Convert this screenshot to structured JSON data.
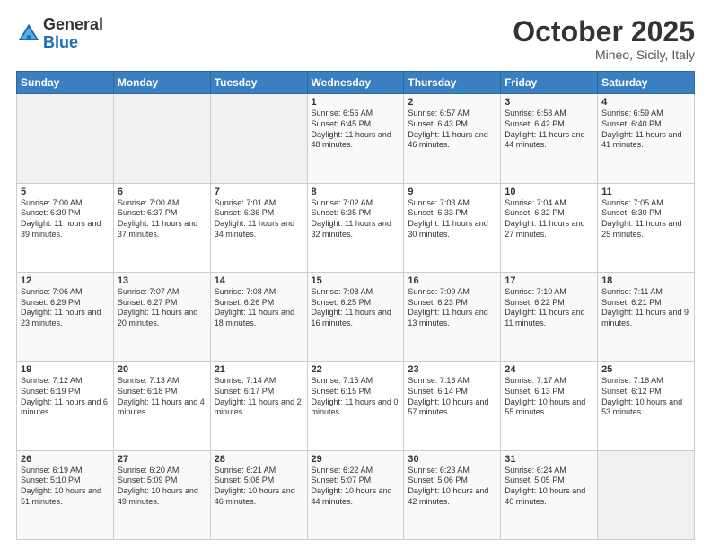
{
  "header": {
    "logo_general": "General",
    "logo_blue": "Blue",
    "month": "October 2025",
    "location": "Mineo, Sicily, Italy"
  },
  "weekdays": [
    "Sunday",
    "Monday",
    "Tuesday",
    "Wednesday",
    "Thursday",
    "Friday",
    "Saturday"
  ],
  "weeks": [
    [
      {
        "day": "",
        "info": ""
      },
      {
        "day": "",
        "info": ""
      },
      {
        "day": "",
        "info": ""
      },
      {
        "day": "1",
        "info": "Sunrise: 6:56 AM\nSunset: 6:45 PM\nDaylight: 11 hours and 48 minutes."
      },
      {
        "day": "2",
        "info": "Sunrise: 6:57 AM\nSunset: 6:43 PM\nDaylight: 11 hours and 46 minutes."
      },
      {
        "day": "3",
        "info": "Sunrise: 6:58 AM\nSunset: 6:42 PM\nDaylight: 11 hours and 44 minutes."
      },
      {
        "day": "4",
        "info": "Sunrise: 6:59 AM\nSunset: 6:40 PM\nDaylight: 11 hours and 41 minutes."
      }
    ],
    [
      {
        "day": "5",
        "info": "Sunrise: 7:00 AM\nSunset: 6:39 PM\nDaylight: 11 hours and 39 minutes."
      },
      {
        "day": "6",
        "info": "Sunrise: 7:00 AM\nSunset: 6:37 PM\nDaylight: 11 hours and 37 minutes."
      },
      {
        "day": "7",
        "info": "Sunrise: 7:01 AM\nSunset: 6:36 PM\nDaylight: 11 hours and 34 minutes."
      },
      {
        "day": "8",
        "info": "Sunrise: 7:02 AM\nSunset: 6:35 PM\nDaylight: 11 hours and 32 minutes."
      },
      {
        "day": "9",
        "info": "Sunrise: 7:03 AM\nSunset: 6:33 PM\nDaylight: 11 hours and 30 minutes."
      },
      {
        "day": "10",
        "info": "Sunrise: 7:04 AM\nSunset: 6:32 PM\nDaylight: 11 hours and 27 minutes."
      },
      {
        "day": "11",
        "info": "Sunrise: 7:05 AM\nSunset: 6:30 PM\nDaylight: 11 hours and 25 minutes."
      }
    ],
    [
      {
        "day": "12",
        "info": "Sunrise: 7:06 AM\nSunset: 6:29 PM\nDaylight: 11 hours and 23 minutes."
      },
      {
        "day": "13",
        "info": "Sunrise: 7:07 AM\nSunset: 6:27 PM\nDaylight: 11 hours and 20 minutes."
      },
      {
        "day": "14",
        "info": "Sunrise: 7:08 AM\nSunset: 6:26 PM\nDaylight: 11 hours and 18 minutes."
      },
      {
        "day": "15",
        "info": "Sunrise: 7:08 AM\nSunset: 6:25 PM\nDaylight: 11 hours and 16 minutes."
      },
      {
        "day": "16",
        "info": "Sunrise: 7:09 AM\nSunset: 6:23 PM\nDaylight: 11 hours and 13 minutes."
      },
      {
        "day": "17",
        "info": "Sunrise: 7:10 AM\nSunset: 6:22 PM\nDaylight: 11 hours and 11 minutes."
      },
      {
        "day": "18",
        "info": "Sunrise: 7:11 AM\nSunset: 6:21 PM\nDaylight: 11 hours and 9 minutes."
      }
    ],
    [
      {
        "day": "19",
        "info": "Sunrise: 7:12 AM\nSunset: 6:19 PM\nDaylight: 11 hours and 6 minutes."
      },
      {
        "day": "20",
        "info": "Sunrise: 7:13 AM\nSunset: 6:18 PM\nDaylight: 11 hours and 4 minutes."
      },
      {
        "day": "21",
        "info": "Sunrise: 7:14 AM\nSunset: 6:17 PM\nDaylight: 11 hours and 2 minutes."
      },
      {
        "day": "22",
        "info": "Sunrise: 7:15 AM\nSunset: 6:15 PM\nDaylight: 11 hours and 0 minutes."
      },
      {
        "day": "23",
        "info": "Sunrise: 7:16 AM\nSunset: 6:14 PM\nDaylight: 10 hours and 57 minutes."
      },
      {
        "day": "24",
        "info": "Sunrise: 7:17 AM\nSunset: 6:13 PM\nDaylight: 10 hours and 55 minutes."
      },
      {
        "day": "25",
        "info": "Sunrise: 7:18 AM\nSunset: 6:12 PM\nDaylight: 10 hours and 53 minutes."
      }
    ],
    [
      {
        "day": "26",
        "info": "Sunrise: 6:19 AM\nSunset: 5:10 PM\nDaylight: 10 hours and 51 minutes."
      },
      {
        "day": "27",
        "info": "Sunrise: 6:20 AM\nSunset: 5:09 PM\nDaylight: 10 hours and 49 minutes."
      },
      {
        "day": "28",
        "info": "Sunrise: 6:21 AM\nSunset: 5:08 PM\nDaylight: 10 hours and 46 minutes."
      },
      {
        "day": "29",
        "info": "Sunrise: 6:22 AM\nSunset: 5:07 PM\nDaylight: 10 hours and 44 minutes."
      },
      {
        "day": "30",
        "info": "Sunrise: 6:23 AM\nSunset: 5:06 PM\nDaylight: 10 hours and 42 minutes."
      },
      {
        "day": "31",
        "info": "Sunrise: 6:24 AM\nSunset: 5:05 PM\nDaylight: 10 hours and 40 minutes."
      },
      {
        "day": "",
        "info": ""
      }
    ]
  ]
}
